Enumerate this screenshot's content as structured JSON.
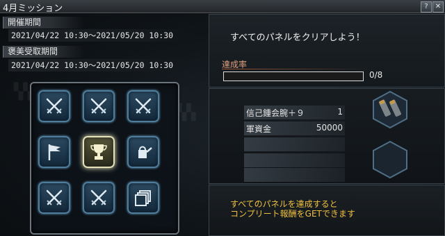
{
  "window": {
    "title": "4月ミッション",
    "help_label": "?",
    "close_label": "✕"
  },
  "period": {
    "event_label": "開催期間",
    "event_range": "2021/04/22 10:30～2021/05/20 10:30",
    "reward_label": "褒美受取期間",
    "reward_range": "2021/04/22 10:30～2021/05/20 10:30"
  },
  "panels": [
    {
      "icon": "crossed-swords-icon"
    },
    {
      "icon": "crossed-swords-icon"
    },
    {
      "icon": "crossed-swords-icon"
    },
    {
      "icon": "flag-icon"
    },
    {
      "icon": "trophy-icon",
      "active": true
    },
    {
      "icon": "watering-can-icon"
    },
    {
      "icon": "crossed-swords-icon"
    },
    {
      "icon": "crossed-swords-icon"
    },
    {
      "icon": "cards-icon"
    }
  ],
  "mission": {
    "message": "すべてのパネルをクリアしよう！",
    "rate_label": "達成率",
    "progress": 0,
    "count_text": "0/8"
  },
  "rewards": [
    {
      "name": "信己鍾会腕＋９",
      "qty": "1"
    },
    {
      "name": "軍資金",
      "qty": "50000"
    },
    {
      "name": "",
      "qty": ""
    },
    {
      "name": "",
      "qty": ""
    },
    {
      "name": "",
      "qty": ""
    }
  ],
  "complete_note": {
    "line1": "すべてのパネルを達成すると",
    "line2": "コンプリート報酬をGETできます"
  },
  "colors": {
    "tile_border": "#4f7d9e",
    "note": "#f0c040",
    "rate_label": "#e0a080"
  }
}
